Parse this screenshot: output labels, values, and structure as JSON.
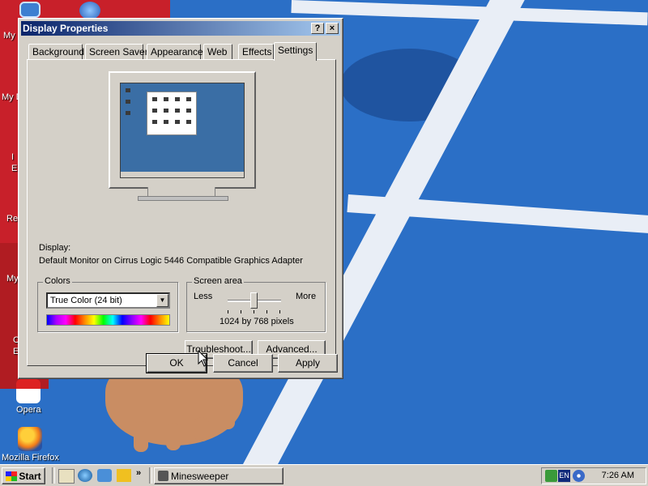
{
  "desktop": {
    "icons": [
      {
        "label": "My"
      },
      {
        "label": "My D"
      },
      {
        "label": "I"
      },
      {
        "label": "E"
      },
      {
        "label": "Re"
      },
      {
        "label": "My"
      },
      {
        "label": "C"
      },
      {
        "label": "E"
      },
      {
        "label": "Opera"
      },
      {
        "label": "Mozilla Firefox"
      }
    ]
  },
  "window": {
    "title": "Display Properties",
    "help_label": "?",
    "close_label": "×",
    "tabs": [
      {
        "label": "Background"
      },
      {
        "label": "Screen Saver"
      },
      {
        "label": "Appearance"
      },
      {
        "label": "Web"
      },
      {
        "label": "Effects"
      },
      {
        "label": "Settings"
      }
    ],
    "active_tab": "Settings",
    "display_label": "Display:",
    "display_value": "Default Monitor on Cirrus Logic 5446 Compatible Graphics Adapter",
    "colors": {
      "title": "Colors",
      "selected": "True Color (24 bit)",
      "arrow": "▼"
    },
    "screen_area": {
      "title": "Screen area",
      "less_label": "Less",
      "more_label": "More",
      "resolution": "1024 by 768 pixels",
      "slider_position": 0.5
    },
    "buttons": {
      "troubleshoot": "Troubleshoot...",
      "advanced": "Advanced...",
      "ok": "OK",
      "cancel": "Cancel",
      "apply": "Apply"
    }
  },
  "taskbar": {
    "start_label": "Start",
    "quick_launch_more": "»",
    "task": {
      "label": "Minesweeper"
    },
    "tray": {
      "lang": "EN",
      "time": "7:26 AM"
    }
  }
}
